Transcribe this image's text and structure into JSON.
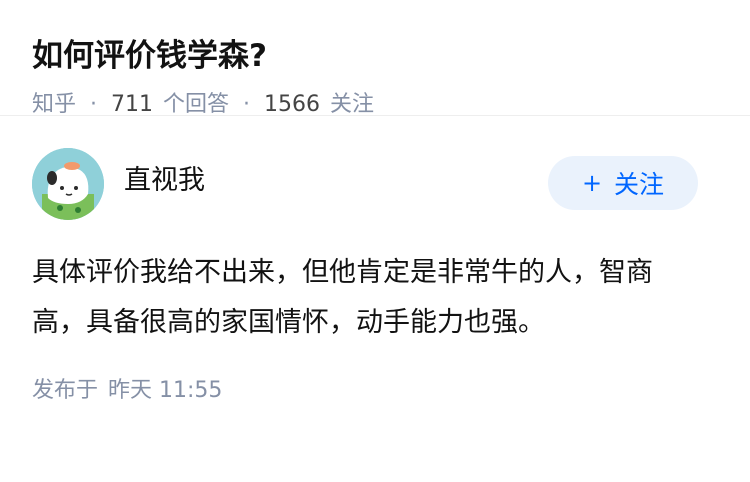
{
  "question": {
    "title": "如何评价钱学森?",
    "source": "知乎",
    "answers_count": "711",
    "answers_label": "个回答",
    "followers_count": "1566",
    "followers_label": "关注",
    "separator": "·"
  },
  "answer": {
    "author_name": "直视我",
    "follow_button_plus": "+",
    "follow_button_label": "关注",
    "content": "具体评价我给不出来，但他肯定是非常牛的人，智商高，具备很高的家国情怀，动手能力也强。",
    "published_label": "发布于",
    "published_time": "昨天 11:55"
  },
  "colors": {
    "accent": "#0066ff",
    "meta": "#8590a6",
    "button_bg": "#eaf2fc"
  }
}
